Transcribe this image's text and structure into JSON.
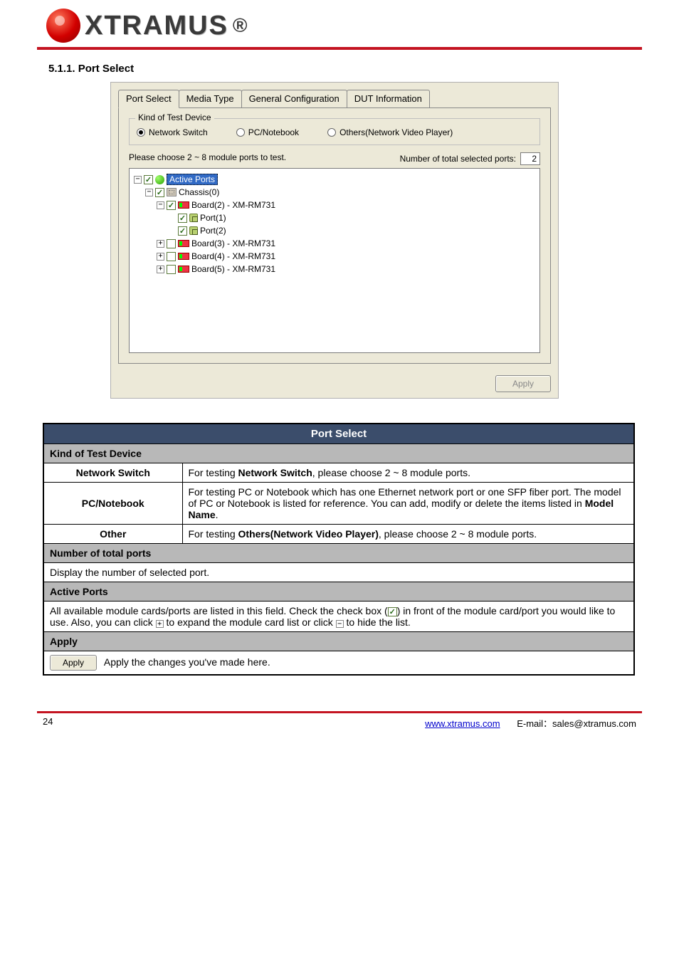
{
  "brand": "XTRAMUS",
  "section_heading": "5.1.1. Port Select",
  "tabs": [
    "Port Select",
    "Media Type",
    "General Configuration",
    "DUT Information"
  ],
  "active_tab": 0,
  "groupbox_title": "Kind of Test Device",
  "radios": [
    {
      "label": "Network Switch",
      "selected": true
    },
    {
      "label": "PC/Notebook",
      "selected": false
    },
    {
      "label": "Others(Network Video Player)",
      "selected": false
    }
  ],
  "choose_text": "Please choose 2 ~ 8 module ports to test.",
  "total_label": "Number of total selected ports:",
  "total_value": "2",
  "tree": {
    "root": "Active Ports",
    "chassis": "Chassis(0)",
    "boards": [
      {
        "label": "Board(2) - XM-RM731",
        "checked": true,
        "expanded": true,
        "ports": [
          "Port(1)",
          "Port(2)"
        ]
      },
      {
        "label": "Board(3) - XM-RM731",
        "checked": false,
        "expanded": false
      },
      {
        "label": "Board(4) - XM-RM731",
        "checked": false,
        "expanded": false
      },
      {
        "label": "Board(5) - XM-RM731",
        "checked": false,
        "expanded": false
      }
    ]
  },
  "apply_label": "Apply",
  "table": {
    "title": "Port Select",
    "group1": {
      "header": "Kind of Test Device",
      "rows": [
        {
          "left": "Network Switch",
          "right_a": "For testing ",
          "right_b": "Network Switch",
          "right_c": ", please choose 2 ~ 8 module ports."
        },
        {
          "left": "PC/Notebook",
          "right_a": "For testing PC or Notebook which has one Ethernet network port or one SFP fiber port. The model of PC or Notebook is listed for reference. You can add, modify or delete the items listed in ",
          "right_b": "Model Name",
          "right_c": "."
        },
        {
          "left": "Other",
          "right_a": "For testing ",
          "right_b": "Others(Network Video Player)",
          "right_c": ", please choose 2 ~ 8 module ports."
        }
      ]
    },
    "total_row": {
      "left": "Number of total ports",
      "right": "Display the number of selected port."
    },
    "active_header": "Active Ports",
    "active_text_a": "All available module cards/ports are listed in this field. Check the check box (",
    "active_text_b": ") in front of the module card/port you would like to use. Also, you can click ",
    "active_text_c": " to expand the module card list or click ",
    "active_text_d": " to hide the list.",
    "apply_header": "Apply",
    "apply_right": "Apply the changes you've made here."
  },
  "footer": {
    "page": "24",
    "url": "www.xtramus.com",
    "email": "E-mail：sales@xtramus.com"
  }
}
